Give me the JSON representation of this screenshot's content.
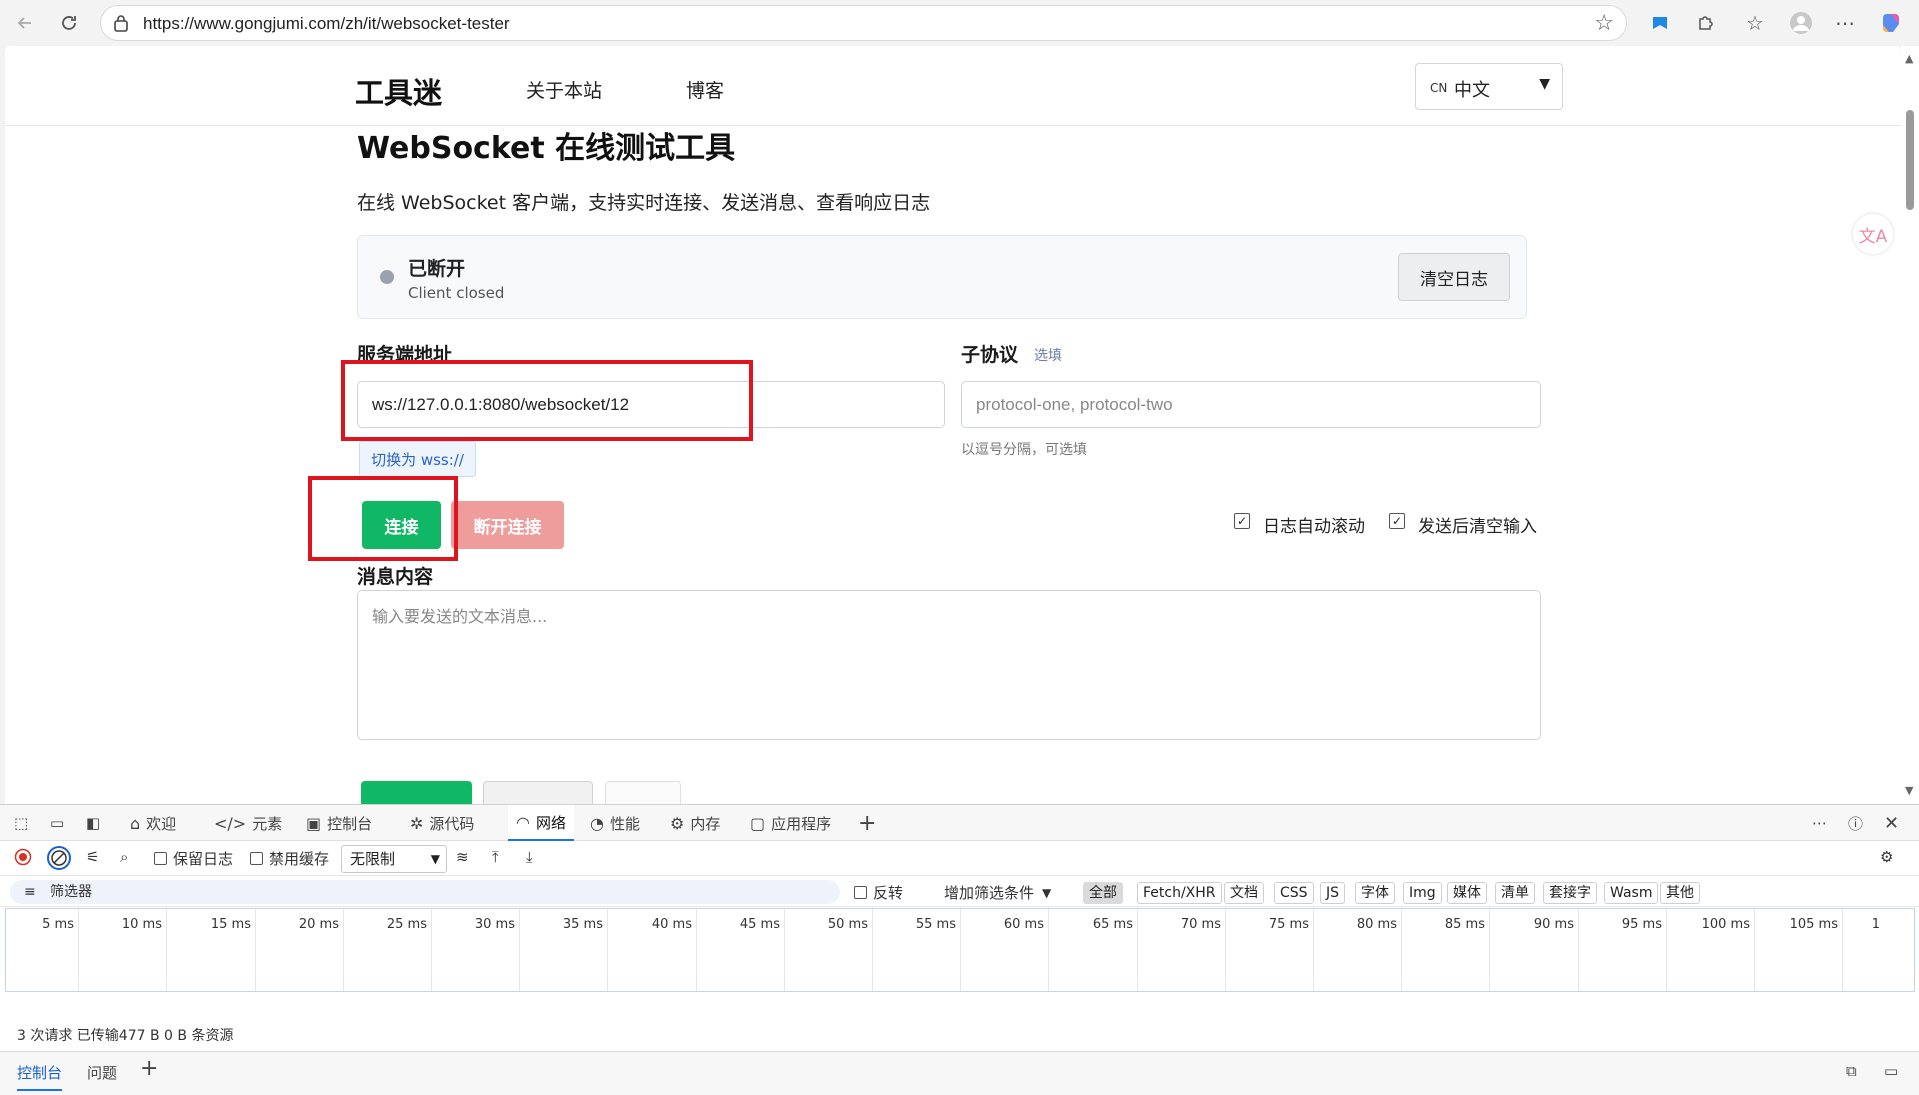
{
  "browser": {
    "url": "https://www.gongjumi.com/zh/it/websocket-tester"
  },
  "site": {
    "logo": "工具迷",
    "nav": [
      "关于本站",
      "博客"
    ],
    "lang_code": "CN",
    "lang_label": "中文"
  },
  "page": {
    "title": "WebSocket 在线测试工具",
    "subtitle": "在线 WebSocket 客户端，支持实时连接、发送消息、查看响应日志"
  },
  "status": {
    "title": "已断开",
    "detail": "Client closed",
    "clear_log": "清空日志"
  },
  "form": {
    "server_label": "服务端地址",
    "server_value": "ws://127.0.0.1:8080/websocket/12",
    "switch_wss": "切换为 wss://",
    "subprotocol_label": "子协议",
    "subprotocol_optional": "选填",
    "subprotocol_placeholder": "protocol-one, protocol-two",
    "subprotocol_help": "以逗号分隔，可选填",
    "connect": "连接",
    "disconnect": "断开连接",
    "auto_scroll": "日志自动滚动",
    "clear_after_send": "发送后清空输入",
    "message_label": "消息内容",
    "message_placeholder": "输入要发送的文本消息..."
  },
  "devtools": {
    "tabs": [
      {
        "label": "欢迎",
        "icon": "home-icon"
      },
      {
        "label": "元素",
        "icon": "code-icon"
      },
      {
        "label": "控制台",
        "icon": "console-icon"
      },
      {
        "label": "源代码",
        "icon": "bug-icon"
      },
      {
        "label": "网络",
        "icon": "wifi-icon"
      },
      {
        "label": "性能",
        "icon": "gauge-icon"
      },
      {
        "label": "内存",
        "icon": "memory-icon"
      },
      {
        "label": "应用程序",
        "icon": "app-icon"
      }
    ],
    "preserve_log": "保留日志",
    "disable_cache": "禁用缓存",
    "throttle": "无限制",
    "filter_placeholder": "筛选器",
    "invert": "反转",
    "more_filters": "增加筛选条件",
    "type_filters": [
      "全部",
      "Fetch/XHR",
      "文档",
      "CSS",
      "JS",
      "字体",
      "Img",
      "媒体",
      "清单",
      "套接字",
      "Wasm",
      "其他"
    ],
    "timeline_ticks": [
      "5 ms",
      "10 ms",
      "15 ms",
      "20 ms",
      "25 ms",
      "30 ms",
      "35 ms",
      "40 ms",
      "45 ms",
      "50 ms",
      "55 ms",
      "60 ms",
      "65 ms",
      "70 ms",
      "75 ms",
      "80 ms",
      "85 ms",
      "90 ms",
      "95 ms",
      "100 ms",
      "105 ms",
      "1"
    ],
    "summary": "3 次请求   已传输477 B   0 B 条资源",
    "drawer_tabs": [
      "控制台",
      "问题"
    ]
  }
}
